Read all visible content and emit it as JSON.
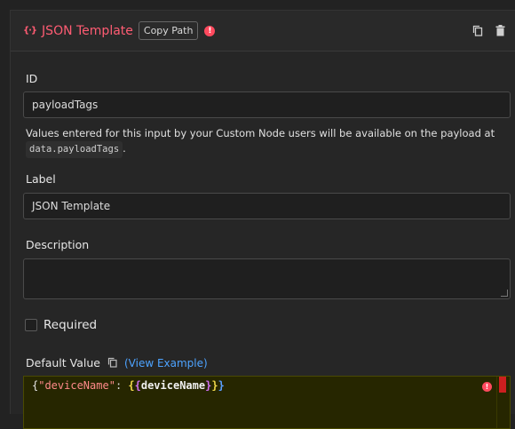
{
  "header": {
    "type_icon": "{·}",
    "title": "JSON Template",
    "copy_path_label": "Copy Path",
    "warning_symbol": "!"
  },
  "id_field": {
    "label": "ID",
    "value": "payloadTags",
    "help_text": "Values entered for this input by your Custom Node users will be available on the payload at",
    "help_code": "data.payloadTags",
    "help_suffix": "."
  },
  "label_field": {
    "label": "Label",
    "value": "JSON Template"
  },
  "description_field": {
    "label": "Description",
    "value": ""
  },
  "required": {
    "label": "Required",
    "checked": false
  },
  "default_value": {
    "label": "Default Value",
    "link": "(View Example)",
    "code": {
      "open": "{",
      "key": "\"deviceName\"",
      "colon": ": ",
      "tpl_open1": "{",
      "tpl_open2": "{",
      "tpl_var": "deviceName",
      "tpl_close1": "}",
      "tpl_close2": "}",
      "close": "}"
    },
    "error_symbol": "!"
  },
  "colors": {
    "accent": "#ff5c73",
    "link": "#4da3ff",
    "error": "#ff4a5e",
    "editor_bg": "#262600"
  }
}
